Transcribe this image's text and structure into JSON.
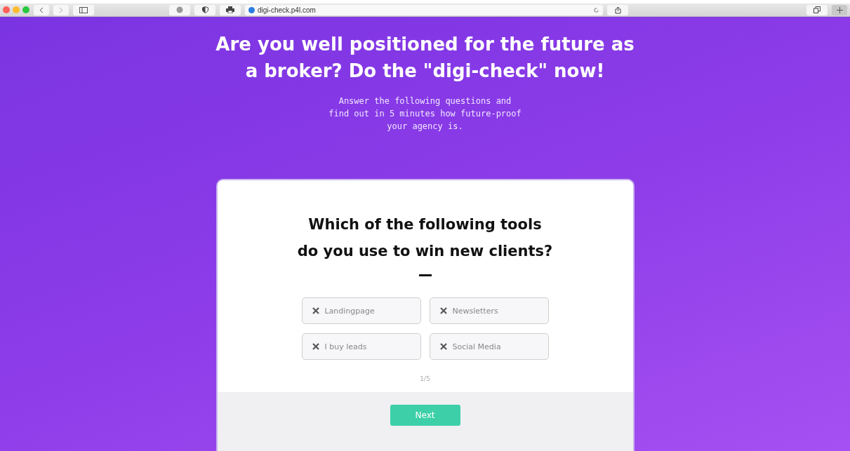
{
  "browser": {
    "url": "digi-check.p4l.com"
  },
  "hero": {
    "heading_lines": [
      "Are you well positioned for the future as",
      "a broker? Do the \"digi-check\" now!"
    ],
    "subtitle_lines": [
      "Answer the following questions and",
      "find out in 5 minutes how future-proof",
      "your agency is."
    ]
  },
  "quiz": {
    "question_lines": [
      "Which of the following tools",
      "do you use to win new clients?"
    ],
    "options": [
      {
        "label": "Landingpage",
        "selected": false
      },
      {
        "label": "Newsletters",
        "selected": false
      },
      {
        "label": "I buy leads",
        "selected": false
      },
      {
        "label": "Social Media",
        "selected": false
      }
    ],
    "progress": "1/5",
    "next_button": "Next"
  }
}
